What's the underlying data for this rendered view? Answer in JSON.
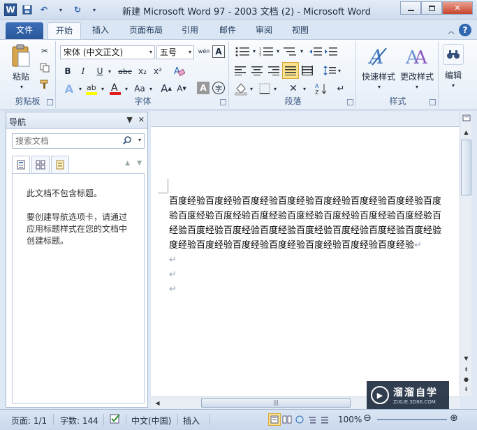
{
  "window": {
    "title": "新建 Microsoft Word 97 - 2003 文档 (2) - Microsoft Word",
    "minimize": "▭",
    "maximize": "▢",
    "close": "✕"
  },
  "qat": {
    "app_icon": "W",
    "save_icon": "💾",
    "undo_icon": "↶",
    "redo_icon": "↻",
    "customize": "▾"
  },
  "tabs": [
    {
      "label": "文件"
    },
    {
      "label": "开始"
    },
    {
      "label": "插入"
    },
    {
      "label": "页面布局"
    },
    {
      "label": "引用"
    },
    {
      "label": "邮件"
    },
    {
      "label": "审阅"
    },
    {
      "label": "视图"
    }
  ],
  "ribbon": {
    "clipboard": {
      "label": "剪贴板",
      "paste": "粘贴"
    },
    "font": {
      "label": "字体",
      "font_name": "宋体 (中文正文)",
      "font_size": "五号",
      "bold": "B",
      "italic": "I",
      "underline": "U",
      "strike": "abc",
      "sub": "x₂",
      "sup": "x²",
      "grow": "A",
      "shrink": "A",
      "change_case": "Aa",
      "clear": "A",
      "wen": "wén",
      "enclose": "字"
    },
    "paragraph": {
      "label": "段落"
    },
    "styles": {
      "label": "样式",
      "quick_styles": "快速样式",
      "change_styles": "更改样式"
    },
    "editing": {
      "label": "编辑",
      "find": "编辑"
    }
  },
  "nav": {
    "title": "导航",
    "search_placeholder": "搜索文档",
    "msg1": "此文档不包含标题。",
    "msg2": "要创建导航选项卡，请通过应用标题样式在您的文档中创建标题。"
  },
  "document": {
    "lines": [
      "百度经验百度经验百度经验百度经验百度经验百度经验百度经验百度",
      "验百度经验百度经验百度经验百度经验百度经验百度经验百度经验百",
      "经验百度经验百度经验百度经验百度经验百度经验百度经验百度经验",
      "度经验百度经验百度经验百度经验百度经验百度经验百度经验"
    ],
    "para_mark": "↵"
  },
  "status": {
    "page": "页面: 1/1",
    "words": "字数: 144",
    "language": "中文(中国)",
    "mode": "插入",
    "zoom": "100%",
    "zoom_level": 1.0
  },
  "watermark": {
    "main": "溜溜自学",
    "sub": "ZIXUE.3D66.COM"
  }
}
